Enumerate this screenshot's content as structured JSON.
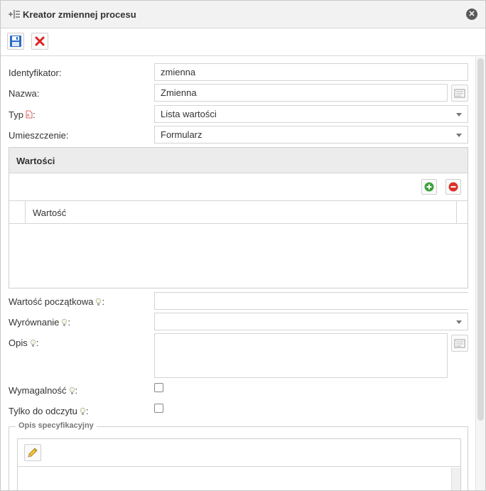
{
  "dialog": {
    "title": "Kreator zmiennej procesu"
  },
  "form": {
    "identyfikator": {
      "label": "Identyfikator:",
      "value": "zmienna"
    },
    "nazwa": {
      "label": "Nazwa:",
      "value": "Zmienna"
    },
    "typ": {
      "label": "Typ",
      "colon": ":",
      "value": "Lista wartości"
    },
    "umieszczenie": {
      "label": "Umieszczenie:",
      "value": "Formularz"
    },
    "wartosci_panel": {
      "title": "Wartości",
      "column": "Wartość"
    },
    "wartosc_poczatkowa": {
      "label": "Wartość początkowa",
      "colon": ":",
      "value": ""
    },
    "wyrownanie": {
      "label": "Wyrównanie",
      "colon": ":",
      "value": ""
    },
    "opis": {
      "label": "Opis",
      "colon": ":",
      "value": ""
    },
    "wymagalnosc": {
      "label": "Wymagalność",
      "colon": ":",
      "checked": false
    },
    "tylko_do_odczytu": {
      "label": "Tylko do odczytu",
      "colon": ":",
      "checked": false
    },
    "opis_specyfikacyjny": {
      "legend": "Opis specyfikacyjny"
    }
  },
  "icons": {
    "title": "variable-list-icon",
    "close": "close-icon",
    "save": "save-icon",
    "delete": "delete-icon",
    "pdf": "pdf-icon",
    "hint": "lightbulb-icon",
    "note": "note-icon",
    "add": "add-icon",
    "remove": "remove-icon",
    "edit": "pencil-icon"
  },
  "colors": {
    "save_blue": "#2b6cc4",
    "delete_red": "#e02020",
    "add_green": "#3ca33c",
    "remove_red": "#d9342b"
  }
}
